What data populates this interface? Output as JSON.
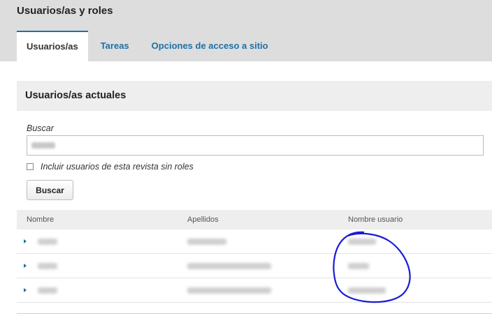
{
  "page": {
    "title": "Usuarios/as y roles"
  },
  "tabs": [
    {
      "label": "Usuarios/as",
      "active": true
    },
    {
      "label": "Tareas",
      "active": false
    },
    {
      "label": "Opciones de acceso a sitio",
      "active": false
    }
  ],
  "panel": {
    "title": "Usuarios/as actuales"
  },
  "search": {
    "label": "Buscar",
    "value_redacted": true,
    "checkbox_label": "Incluir usuarios de esta revista sin roles",
    "checkbox_checked": false,
    "button_label": "Buscar"
  },
  "table": {
    "headers": {
      "first_name": "Nombre",
      "last_name": "Apellidos",
      "username": "Nombre usuario"
    },
    "rows": [
      {
        "redacted": true
      },
      {
        "redacted": true
      },
      {
        "redacted": true
      }
    ]
  },
  "colors": {
    "link": "#1d70a8",
    "annotation": "#1a1ad6"
  },
  "icons": {
    "row_expand": "caret-right-icon"
  }
}
